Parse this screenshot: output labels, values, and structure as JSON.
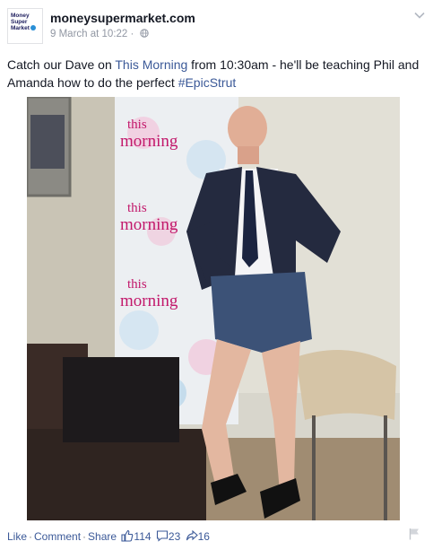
{
  "page": {
    "logo_lines": [
      "Money",
      "Super",
      "Market"
    ],
    "name": "moneysupermarket.com",
    "timestamp": "9 March at 10:22",
    "separator": "·"
  },
  "message": {
    "part1": "Catch our Dave on ",
    "link": "This Morning",
    "part2": " from 10:30am - he'll be teaching Phil and Amanda how to do the perfect ",
    "hashtag": "#EpicStrut"
  },
  "photo": {
    "banner_text": [
      "this",
      "morning"
    ]
  },
  "actions": {
    "like": "Like",
    "comment": "Comment",
    "share": "Share",
    "likes_count": "114",
    "comments_count": "23",
    "shares_count": "16"
  },
  "icons": {
    "globe": "globe-icon",
    "chevron": "chevron-down-icon",
    "like": "thumbs-up-icon",
    "comment": "comment-icon",
    "share": "share-icon",
    "flag": "flag-icon"
  },
  "colors": {
    "link": "#3b5998",
    "meta": "#9197a3",
    "banner_pink": "#c2186b"
  }
}
